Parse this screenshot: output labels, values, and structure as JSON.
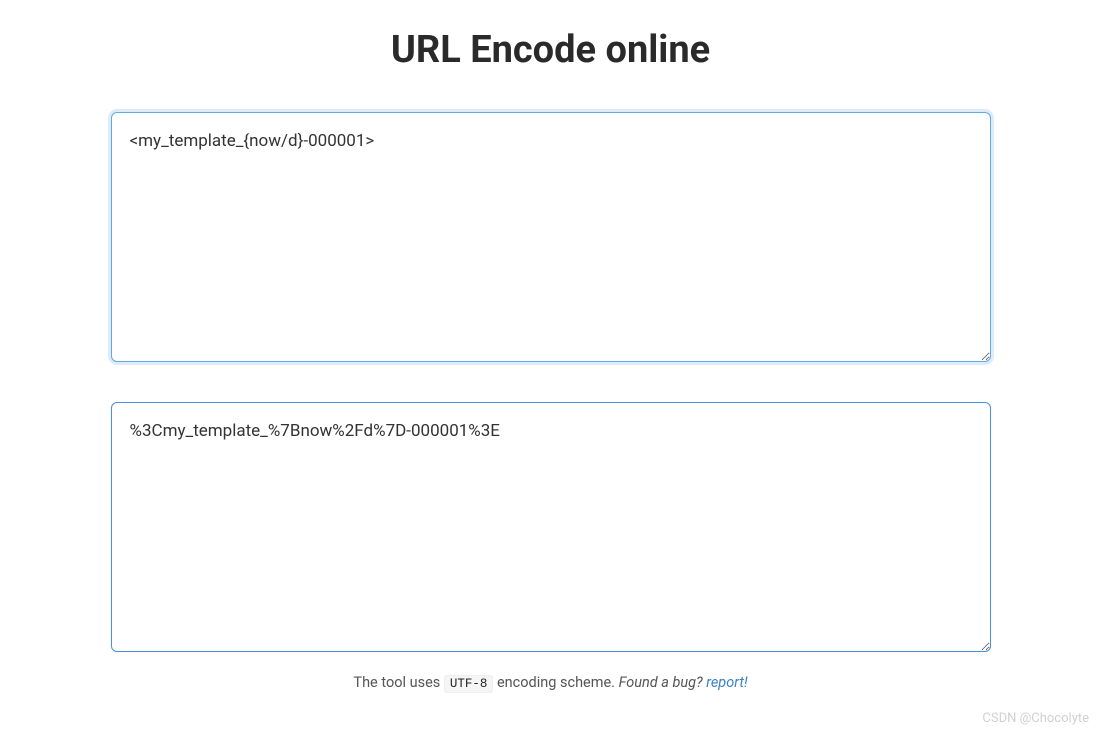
{
  "header": {
    "title": "URL Encode online"
  },
  "input": {
    "value": "<my_template_{now/d}-000001>"
  },
  "output": {
    "value": "%3Cmy_template_%7Bnow%2Fd%7D-000001%3E"
  },
  "footer": {
    "prefix": "The tool uses ",
    "encoding": "UTF-8",
    "suffix": " encoding scheme. ",
    "bug_prompt": "Found a bug? ",
    "report_link": "report!"
  },
  "watermark": "CSDN @Chocolyte"
}
